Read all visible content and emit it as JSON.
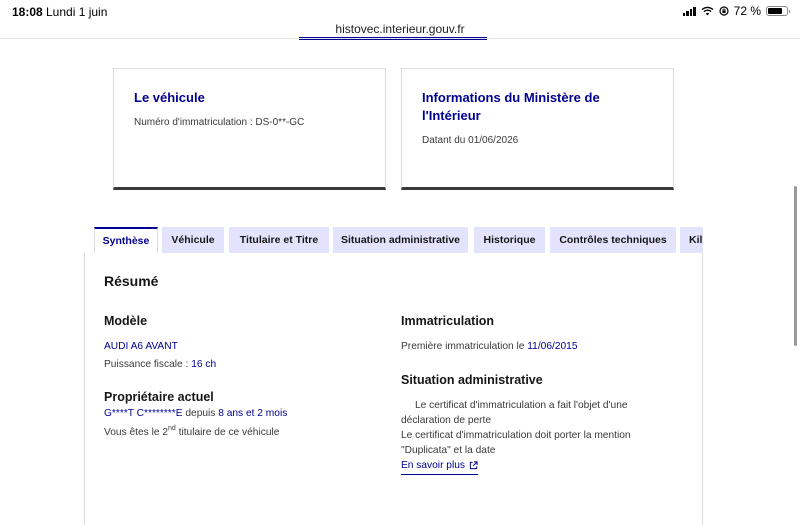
{
  "status_bar": {
    "time": "18:08",
    "date": "Lundi 1 juin",
    "battery": "72 %"
  },
  "browser": {
    "url": "histovec.interieur.gouv.fr"
  },
  "cards": [
    {
      "title": "Le véhicule",
      "text": "Numéro d'immatriculation : DS-0**-GC"
    },
    {
      "title": "Informations du Ministère de l'Intérieur",
      "text": "Datant du 01/06/2026"
    }
  ],
  "tabs": [
    {
      "label": "Synthèse",
      "active": true
    },
    {
      "label": "Véhicule"
    },
    {
      "label": "Titulaire et Titre"
    },
    {
      "label": "Situation administrative"
    },
    {
      "label": "Historique"
    },
    {
      "label": "Contrôles techniques"
    },
    {
      "label": "Kil"
    }
  ],
  "summary": {
    "heading": "Résumé",
    "modele": {
      "heading": "Modèle",
      "model_name": "AUDI A6 AVANT",
      "puissance_label": "Puissance fiscale : ",
      "puissance_value": "16 ch"
    },
    "proprietaire": {
      "heading": "Propriétaire actuel",
      "name": "G****T C********E",
      "depuis_label": " depuis ",
      "depuis_value": "8 ans et 2 mois",
      "titulaire_pre": "Vous êtes le 2",
      "titulaire_sup": "nd",
      "titulaire_post": " titulaire de ce véhicule"
    },
    "immatriculation": {
      "heading": "Immatriculation",
      "label": "Première immatriculation le ",
      "date": "11/06/2015"
    },
    "situation": {
      "heading": "Situation administrative",
      "line1": "Le certificat d'immatriculation a fait l'objet d'une déclaration de perte",
      "line2": "Le certificat d'immatriculation doit porter la mention \"Duplicata\" et la date",
      "link": "En savoir plus"
    }
  },
  "colors": {
    "accent": "#000091",
    "tab_bg": "#e3e3fd",
    "text": "#161616",
    "muted": "#3a3a3a"
  }
}
